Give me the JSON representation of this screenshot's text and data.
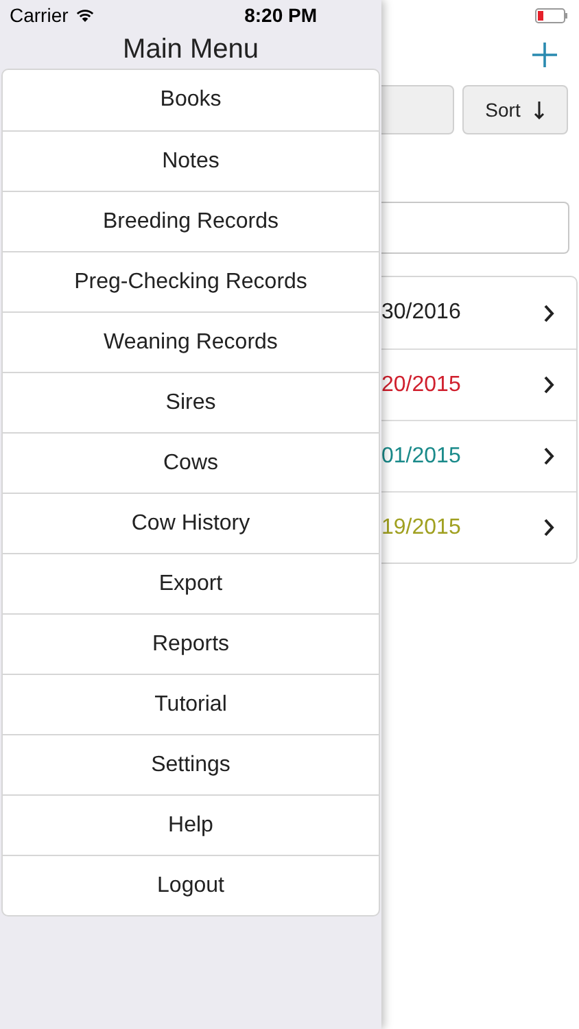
{
  "status_bar": {
    "carrier": "Carrier",
    "time": "8:20 PM"
  },
  "menu": {
    "title": "Main Menu",
    "items": [
      "Books",
      "Notes",
      "Breeding Records",
      "Preg-Checking Records",
      "Weaning Records",
      "Sires",
      "Cows",
      "Cow History",
      "Export",
      "Reports",
      "Tutorial",
      "Settings",
      "Help",
      "Logout"
    ]
  },
  "background": {
    "sort_button": "Sort",
    "rows": [
      {
        "date": "30/2016",
        "color": "#222222"
      },
      {
        "date": "20/2015",
        "color": "#d0202e"
      },
      {
        "date": "01/2015",
        "color": "#1a8a8a"
      },
      {
        "date": "19/2015",
        "color": "#a0a020"
      }
    ]
  }
}
